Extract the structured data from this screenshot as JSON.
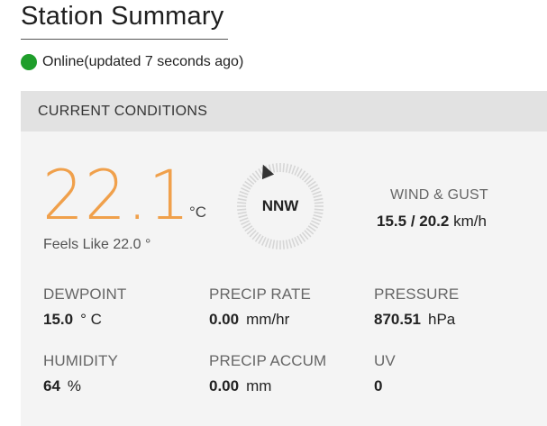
{
  "page": {
    "title": "Station Summary"
  },
  "status": {
    "text": "Online(updated 7 seconds ago)",
    "color": "#1f9e2b"
  },
  "card": {
    "header": "CURRENT CONDITIONS",
    "temperature": {
      "value": "22.1",
      "unit": "°C",
      "feels_like": "Feels Like 22.0 °",
      "color": "#f0a04b"
    },
    "wind": {
      "direction": "NNW",
      "title": "WIND & GUST",
      "speed": "15.5",
      "separator": " / ",
      "gust": "20.2",
      "unit": "km/h"
    },
    "stats": {
      "dewpoint": {
        "label": "DEWPOINT",
        "value": "15.0",
        "unit": "° C"
      },
      "precip_rate": {
        "label": "PRECIP RATE",
        "value": "0.00",
        "unit": "mm/hr"
      },
      "pressure": {
        "label": "PRESSURE",
        "value": "870.51",
        "unit": "hPa"
      },
      "humidity": {
        "label": "HUMIDITY",
        "value": "64",
        "unit": "%"
      },
      "precip_accum": {
        "label": "PRECIP ACCUM",
        "value": "0.00",
        "unit": "mm"
      },
      "uv": {
        "label": "UV",
        "value": "0",
        "unit": ""
      }
    }
  }
}
